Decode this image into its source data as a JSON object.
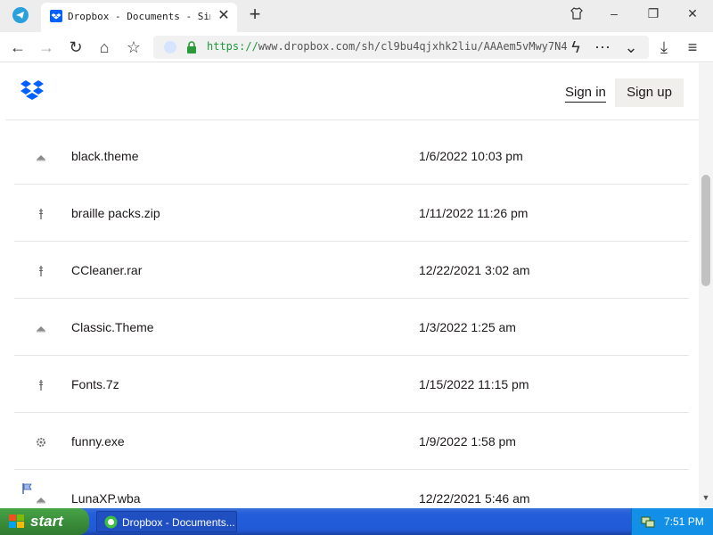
{
  "browser": {
    "tab_title": "Dropbox - Documents - Simpl",
    "url_scheme": "https://",
    "url_rest": "www.dropbox.com/sh/cl9bu4qjxhk2liu/AAAem5vMwy7N4"
  },
  "header": {
    "signin_label": "Sign in",
    "signup_label": "Sign up"
  },
  "files": [
    {
      "name": "black.theme",
      "modified": "1/6/2022 10:03 pm",
      "icon": "theme-file-icon"
    },
    {
      "name": "braille packs.zip",
      "modified": "1/11/2022 11:26 pm",
      "icon": "zip-file-icon"
    },
    {
      "name": "CCleaner.rar",
      "modified": "12/22/2021 3:02 am",
      "icon": "zip-file-icon"
    },
    {
      "name": "Classic.Theme",
      "modified": "1/3/2022 1:25 am",
      "icon": "theme-file-icon"
    },
    {
      "name": "Fonts.7z",
      "modified": "1/15/2022 11:15 pm",
      "icon": "zip-file-icon"
    },
    {
      "name": "funny.exe",
      "modified": "1/9/2022 1:58 pm",
      "icon": "exe-file-icon"
    },
    {
      "name": "LunaXP.wba",
      "modified": "12/22/2021 5:46 am",
      "icon": "theme-file-icon"
    }
  ],
  "taskbar": {
    "start_label": "start",
    "task_label": "Dropbox - Documents...",
    "clock": "7:51 PM"
  },
  "colors": {
    "dropbox_blue": "#0061fe",
    "taskbar_blue": "#245edb",
    "start_green": "#3b8e3b"
  }
}
